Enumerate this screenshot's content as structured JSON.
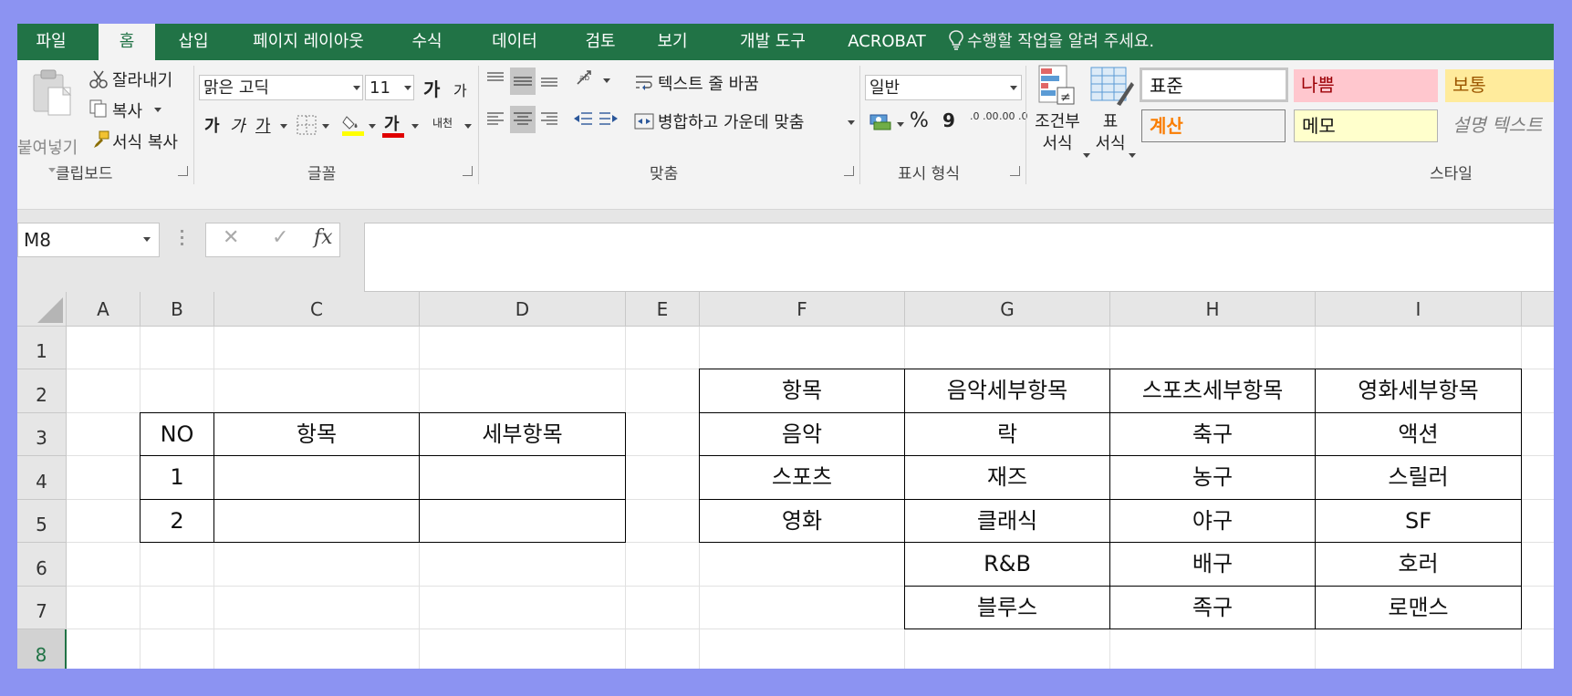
{
  "menu": {
    "tabs": [
      "파일",
      "홈",
      "삽입",
      "페이지 레이아웃",
      "수식",
      "데이터",
      "검토",
      "보기",
      "개발 도구",
      "ACROBAT"
    ],
    "active_tab": "홈",
    "tell_me": "수행할 작업을 알려 주세요."
  },
  "clipboard": {
    "paste": "붙여넣기",
    "cut": "잘라내기",
    "copy": "복사",
    "format_painter": "서식 복사",
    "label": "클립보드"
  },
  "font": {
    "name": "맑은 고딕",
    "size": "11",
    "grow": "가",
    "shrink": "가",
    "bold": "가",
    "italic": "가",
    "underline": "가",
    "font_color": "가",
    "phonetic": "내천",
    "label": "글꼴"
  },
  "alignment": {
    "wrap_text": "텍스트 줄 바꿈",
    "merge_center": "병합하고 가운데 맞춤",
    "label": "맞춤"
  },
  "number": {
    "format": "일반",
    "percent": "%",
    "comma": "9",
    "inc_decimal": ".0 .00",
    "dec_decimal": ".00 .0",
    "label": "표시 형식"
  },
  "styles": {
    "conditional_line1": "조건부",
    "conditional_line2": "서식",
    "table_line1": "표",
    "table_line2": "서식",
    "normal": "표준",
    "bad": "나쁨",
    "neutral": "보통",
    "calculation": "계산",
    "note": "메모",
    "explanatory": "설명 텍스트",
    "label": "스타일"
  },
  "formula_bar": {
    "name_box": "M8",
    "cancel": "✕",
    "enter": "✓",
    "fx": "fx",
    "value": ""
  },
  "columns": [
    "A",
    "B",
    "C",
    "D",
    "E",
    "F",
    "G",
    "H",
    "I"
  ],
  "rows": [
    "1",
    "2",
    "3",
    "4",
    "5",
    "6",
    "7",
    "8"
  ],
  "selected_row": "8",
  "left_table": {
    "headers": [
      "NO",
      "항목",
      "세부항목"
    ],
    "rows": [
      [
        "1",
        "",
        ""
      ],
      [
        "2",
        "",
        ""
      ]
    ]
  },
  "right_table": {
    "headers": [
      "항목",
      "음악세부항목",
      "스포츠세부항목",
      "영화세부항목"
    ],
    "rows": [
      [
        "음악",
        "락",
        "축구",
        "액션"
      ],
      [
        "스포츠",
        "재즈",
        "농구",
        "스릴러"
      ],
      [
        "영화",
        "클래식",
        "야구",
        "SF"
      ],
      [
        "",
        "R&B",
        "배구",
        "호러"
      ],
      [
        "",
        "블루스",
        "족구",
        "로맨스"
      ]
    ]
  },
  "colors": {
    "excel_green": "#217346",
    "bad_bg": "#ffc7ce",
    "bad_text": "#9c0006",
    "neutral_bg": "#ffeb9c",
    "neutral_text": "#9c5700",
    "calc_text": "#fa7d00",
    "note_bg": "#ffffcc"
  }
}
